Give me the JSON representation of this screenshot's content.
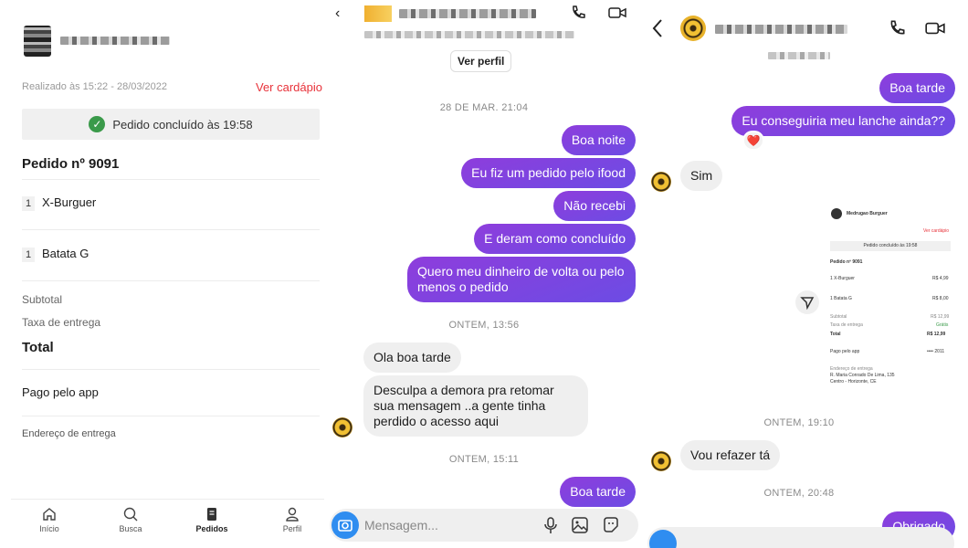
{
  "order": {
    "meta": "Realizado às 15:22 - 28/03/2022",
    "menu_link": "Ver cardápio",
    "status": "Pedido concluído às 19:58",
    "title": "Pedido nº 9091",
    "items": [
      {
        "qty": "1",
        "name": "X-Burguer"
      },
      {
        "qty": "1",
        "name": "Batata G"
      }
    ],
    "subtotal_label": "Subtotal",
    "delivery_label": "Taxa de entrega",
    "total_label": "Total",
    "payment_label": "Pago pelo app",
    "address_label": "Endereço de entrega"
  },
  "nav": {
    "items": [
      {
        "label": "Início",
        "icon": "home-icon"
      },
      {
        "label": "Busca",
        "icon": "search-icon"
      },
      {
        "label": "Pedidos",
        "icon": "orders-icon"
      },
      {
        "label": "Perfil",
        "icon": "profile-icon"
      }
    ]
  },
  "chat1": {
    "profile_button": "Ver perfil",
    "ts1": "28 DE MAR. 21:04",
    "m1": "Boa noite",
    "m2": "Eu fiz um pedido pelo ifood",
    "m3": "Não recebi",
    "m4": "E deram como concluído",
    "m5": "Quero meu dinheiro de volta ou pelo menos o pedido",
    "ts2": "ONTEM, 13:56",
    "r1": "Ola boa tarde",
    "r2": "Desculpa a demora pra retomar sua mensagem ..a gente tinha perdido o acesso aqui",
    "ts3": "ONTEM, 15:11",
    "m6": "Boa tarde",
    "input_placeholder": "Mensagem..."
  },
  "chat2": {
    "m1": "Boa tarde",
    "m2": "Eu conseguiria meu lanche ainda??",
    "reaction": "❤️",
    "r1": "Sim",
    "ts1": "ONTEM, 19:10",
    "r2": "Vou refazer tá",
    "ts2": "ONTEM, 20:48",
    "m3": "Obrigado"
  },
  "screenshot_preview": {
    "store": "Medrugao Burguer",
    "menu_link": "Ver cardápio",
    "status": "Pedido concluído às 19:58",
    "title": "Pedido nº 9091",
    "item1": "1  X-Burguer",
    "item1_price": "R$ 4,99",
    "item2": "1  Batata G",
    "item2_price": "R$ 8,00",
    "subtotal_label": "Subtotal",
    "subtotal": "R$ 12,99",
    "delivery_label": "Taxa de entrega",
    "delivery": "Grátis",
    "total_label": "Total",
    "total": "R$ 12,99",
    "payment_label": "Pago pelo app",
    "payment_detail": "•••• 2011",
    "address_label": "Endereço de entrega",
    "address1": "R. Maria Conrado De Lima, 135",
    "address2": "Centro - Horizonte, CE"
  },
  "colors": {
    "accent_red": "#e8323a",
    "outgoing_bubble": "#7a44e0",
    "incoming_bubble": "#efefef",
    "check_green": "#3a9a4a",
    "camera_blue": "#2f8df0"
  }
}
